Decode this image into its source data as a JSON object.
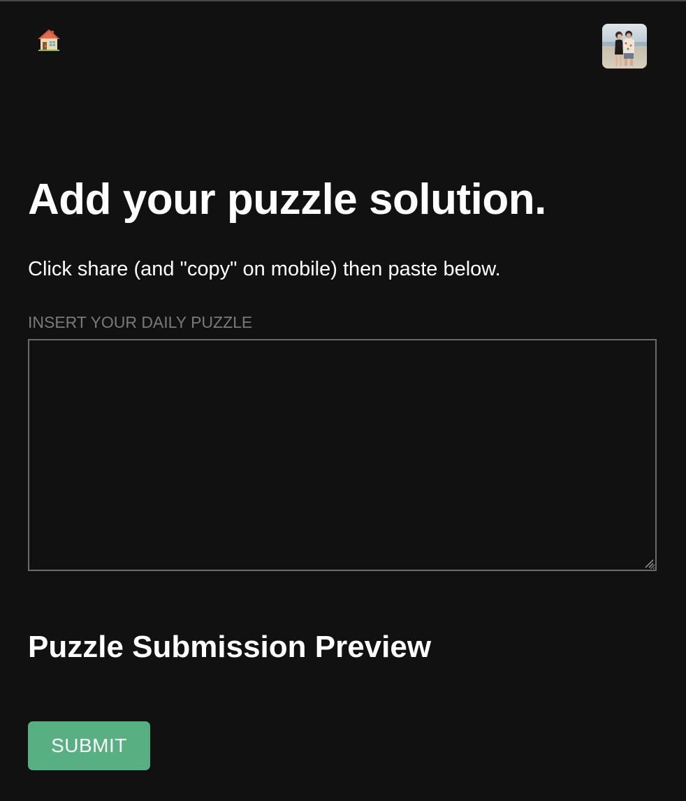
{
  "header": {
    "home_icon": "house-icon",
    "avatar_icon": "user-avatar-photo"
  },
  "main": {
    "title": "Add your puzzle solution.",
    "instructions": "Click share (and \"copy\" on mobile) then paste below.",
    "input_label": "INSERT YOUR DAILY PUZZLE",
    "input_value": "",
    "preview_heading": "Puzzle Submission Preview",
    "submit_label": "SUBMIT"
  },
  "colors": {
    "background": "#111111",
    "text": "#ffffff",
    "label": "#7a7a7a",
    "input_border": "#6a6a6a",
    "submit_button": "#56b082"
  }
}
